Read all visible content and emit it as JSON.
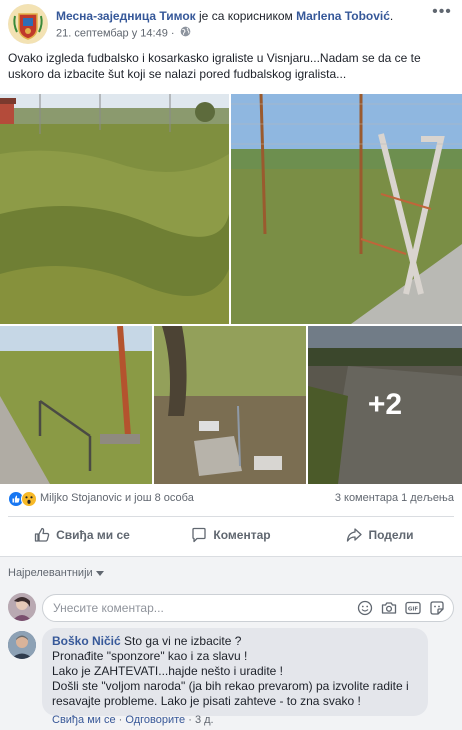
{
  "header": {
    "page_name": "Месна-заједница Тимок",
    "with_text": "је са корисником",
    "tagged_user": "Marlena Tobović",
    "tagged_suffix": ".",
    "timestamp": "21. септембар у 14:49",
    "separator": "·",
    "privacy_icon": "globe-icon",
    "more_icon": "more-options-icon"
  },
  "post": {
    "text": "Ovako izgleda fudbalsko i kosarkasko igraliste u Visnjaru...Nadam se da ce te uskoro da izbacite šut koji se nalazi pored fudbalskog igralista..."
  },
  "photos": {
    "more_count": "+2"
  },
  "reactions": {
    "icons": [
      "like-icon",
      "wow-icon"
    ],
    "names": "Miljko Stojanovic и још 8 особа",
    "counts": "3 коментара  1 дељења"
  },
  "actions": {
    "like": "Свиђа ми се",
    "comment": "Коментар",
    "share": "Подели"
  },
  "comments": {
    "sort_label": "Најрелевантнији",
    "composer_placeholder": "Унесите коментар...",
    "composer_icons": [
      "emoji-icon",
      "camera-icon",
      "gif-icon",
      "sticker-icon"
    ],
    "items": [
      {
        "author": "Boško Ničić",
        "lines": [
          "Sto ga vi ne izbacite ?",
          "Pronađite \"sponzore\" kao i za slavu !",
          "Lako je ZAHTEVATI...hajde nešto i uradite !",
          "Došli ste \"voljom naroda\" (ja bih rekao prevarom) pa izvolite radite i resavajte probleme. Lako je pisati zahteve - to zna svako !"
        ],
        "like_label": "Свиђа ми се",
        "reply_label": "Одговорите",
        "dot": "·",
        "age": "3 д."
      }
    ]
  },
  "colors": {
    "link": "#365899",
    "muted": "#616770",
    "divider": "#dadde1",
    "comments_bg": "#f2f3f5",
    "like_blue": "#1877f2",
    "wow_yellow": "#f7b928"
  }
}
